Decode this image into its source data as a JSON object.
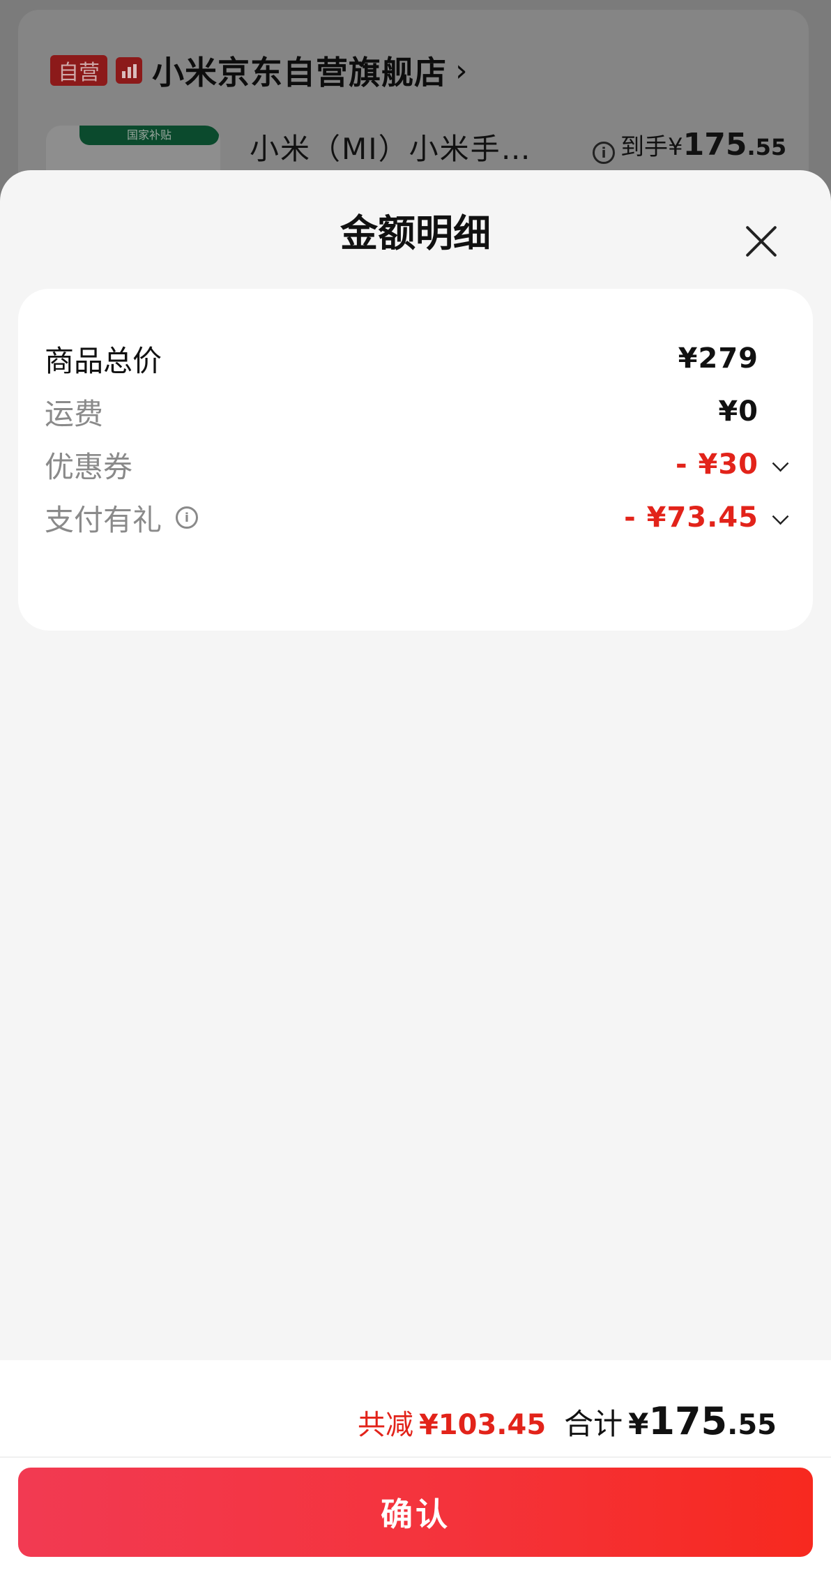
{
  "background": {
    "shop": {
      "badge": "自营",
      "icon": "bar-chart-icon",
      "name": "小米京东自营旗舰店",
      "chevron": "›"
    },
    "product": {
      "thumb_tag": "国家补贴",
      "name": "小米（MI）小米手…",
      "price_label": "到手",
      "price_yen": "¥",
      "price_int": "175",
      "price_dec": ".55"
    }
  },
  "sheet": {
    "title": "金额明细",
    "rows": [
      {
        "label": "商品总价",
        "value": "¥279"
      },
      {
        "label": "运费",
        "value": "¥0"
      },
      {
        "label": "优惠券",
        "value": "- ¥30"
      },
      {
        "label": "支付有礼",
        "value": "- ¥73.45"
      }
    ]
  },
  "footer": {
    "save_label": "共减",
    "save_amount": "¥103.45",
    "total_label": "合计",
    "total_yen": "¥",
    "total_int": "175",
    "total_dec": ".55",
    "confirm_label": "确认"
  },
  "colors": {
    "accent_red": "#e2231a",
    "button_gradient_start": "#f23a52",
    "button_gradient_end": "#f7291f"
  }
}
